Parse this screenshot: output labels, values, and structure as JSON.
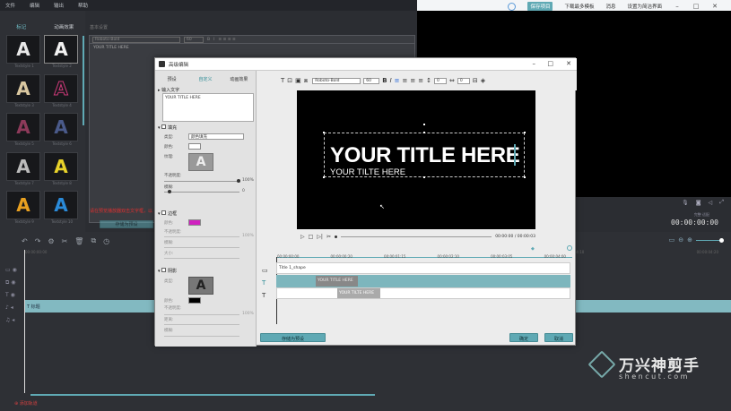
{
  "main_menu": {
    "items": [
      "文件",
      "编辑",
      "输出",
      "帮助"
    ]
  },
  "top_right": {
    "save_project": "保存项目",
    "download": "下载最多模板",
    "messages": "消息",
    "switch_ui": "设置为简洁界面"
  },
  "library": {
    "tabs": [
      "标记",
      "动画效果"
    ],
    "tiles": [
      {
        "letter": "A",
        "label": "Textstyle 1",
        "color": "#e8e8e8"
      },
      {
        "letter": "A",
        "label": "Textstyle 2",
        "color": "#f2f2f2"
      },
      {
        "letter": "A",
        "label": "Textstyle 3",
        "color": "#d9c7a0"
      },
      {
        "letter": "A",
        "label": "Textstyle 4",
        "color": "#cf3a7a"
      },
      {
        "letter": "A",
        "label": "Textstyle 5",
        "color": "#8d3a5a"
      },
      {
        "letter": "A",
        "label": "Textstyle 6",
        "color": "#4a5a8a"
      },
      {
        "letter": "A",
        "label": "Textstyle 7",
        "color": "#bcbcbc"
      },
      {
        "letter": "A",
        "label": "Textstyle 8",
        "color": "#e8d22a"
      },
      {
        "letter": "A",
        "label": "Textstyle 9",
        "color": "#e8a020"
      },
      {
        "letter": "A",
        "label": "Textstyle 10",
        "color": "#2a8ad8"
      }
    ]
  },
  "editor_bg": {
    "section": "基本设置",
    "font": "Roboto-Bold",
    "size": "60",
    "text": "YOUR TITLE HERE",
    "warning": "请在预览播放器双击文字框，以",
    "save_preset": "存储为预设"
  },
  "dialog": {
    "title": "高级编辑",
    "tabs": [
      "预设",
      "自定义",
      "动画效果"
    ],
    "sections": {
      "input_text": "输入文字",
      "input_value": "YOUR TITLE HERE",
      "fill": "填充",
      "fill_type_label": "类型:",
      "fill_type_value": "颜色填充",
      "color_label": "颜色:",
      "texture_label": "纹理:",
      "opacity_label": "不透明度:",
      "opacity_value": "100%",
      "blur_label": "模糊:",
      "blur_value": "0",
      "border": "边框",
      "border_color": "颜色:",
      "border_opacity": "不透明度:",
      "border_blur": "模糊:",
      "border_size": "大小:",
      "shadow": "阴影",
      "shadow_type": "类型:",
      "shadow_color": "颜色:",
      "shadow_opacity": "不透明度:",
      "shadow_distance": "距离:",
      "shadow_blur": "模糊:",
      "slider_val": "100%"
    },
    "toolbar": {
      "font": "Roboto-Bold",
      "size": "60",
      "spacing1": "0",
      "spacing2": "0"
    },
    "canvas": {
      "title": "YOUR TITLE HERE",
      "subtitle": "YOUR TILTE HERE"
    },
    "playback": {
      "time": "00:00:00 / 00:00:03"
    },
    "timeline": {
      "ticks": [
        "00:00:00:00",
        "00:00:00:20",
        "00:00:01:15",
        "00:00:02:10",
        "00:00:03:05",
        "00:00:04:00"
      ],
      "shape_clip": "Title 1_shape",
      "clip1": "YOUR TITLE HERE",
      "clip2": "YOUR TILTE HERE"
    },
    "buttons": {
      "save_preset": "存储为预设",
      "ok": "确定",
      "cancel": "取消"
    }
  },
  "preview": {
    "time": "00:00:00:00",
    "quality": "完整",
    "zoom": "适配"
  },
  "timeline": {
    "ticks": [
      "00:00:00:00",
      "00:00:00:20",
      "00:00:01:10",
      "00:00:04:00",
      "00:00:04:10",
      "00:00:04:20"
    ],
    "title_clip": "T 标题",
    "add_track": "添加轨道"
  },
  "watermark": {
    "name": "万兴神剪手",
    "url": "shencut.com"
  }
}
